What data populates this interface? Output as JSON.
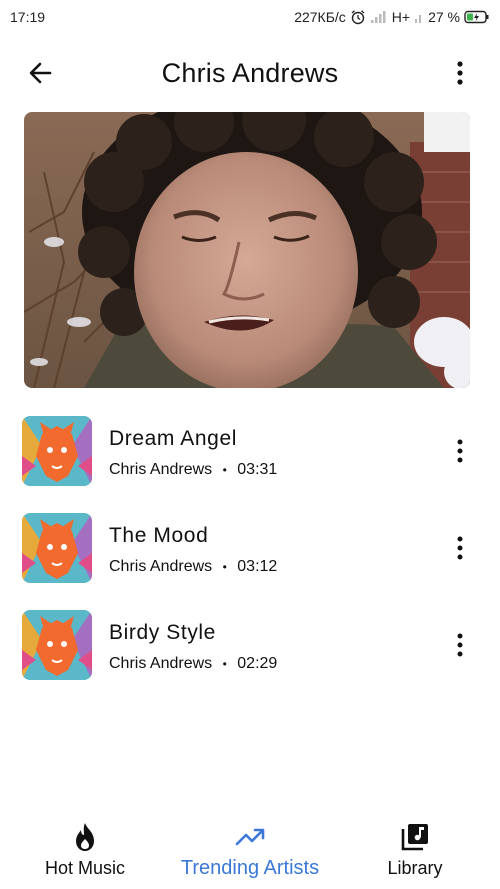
{
  "status_bar": {
    "time": "17:19",
    "network_speed": "227КБ/с",
    "network_type": "H+",
    "battery": "27 %"
  },
  "header": {
    "title": "Chris Andrews",
    "back_icon": "arrow-left-icon",
    "menu_icon": "more-vertical-icon"
  },
  "tracks": [
    {
      "title": "Dream Angel",
      "artist": "Chris Andrews",
      "separator": "•",
      "duration": "03:31"
    },
    {
      "title": "The Mood",
      "artist": "Chris Andrews",
      "separator": "•",
      "duration": "03:12"
    },
    {
      "title": "Birdy Style",
      "artist": "Chris Andrews",
      "separator": "•",
      "duration": "02:29"
    }
  ],
  "bottom_nav": {
    "items": [
      {
        "label": "Hot Music",
        "icon": "flame-icon",
        "active": false
      },
      {
        "label": "Trending Artists",
        "icon": "trending-up-icon",
        "active": true
      },
      {
        "label": "Library",
        "icon": "library-music-icon",
        "active": false
      }
    ]
  },
  "colors": {
    "accent": "#3b78d8",
    "text": "#111111",
    "background": "#ffffff"
  }
}
